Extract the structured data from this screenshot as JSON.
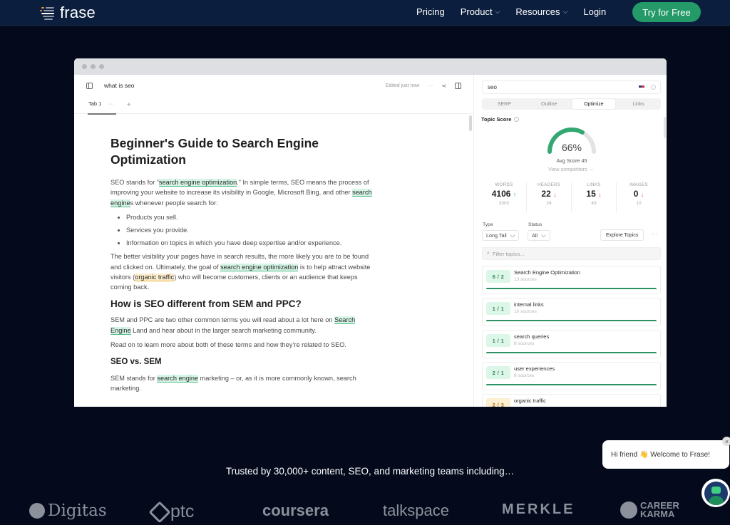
{
  "nav": {
    "brand": "frase",
    "links": [
      {
        "label": "Pricing",
        "has_dropdown": false
      },
      {
        "label": "Product",
        "has_dropdown": true
      },
      {
        "label": "Resources",
        "has_dropdown": true
      },
      {
        "label": "Login",
        "has_dropdown": false
      }
    ],
    "cta": "Try for Free",
    "chevron": "⌄"
  },
  "editor": {
    "doc_title": "what is seo",
    "edited_status": "Edited just now",
    "more": "···",
    "tabs": [
      {
        "label": "Tab 1",
        "more": "···"
      }
    ],
    "add_tab": "+",
    "content": {
      "h1": "Beginner's Guide to Search Engine Optimization",
      "p1": {
        "a": "SEO stands for “",
        "hl1": "search engine optimization",
        "b": ".” In simple terms, SEO means the process of improving your website to increase its visibility in Google, Microsoft Bing, and other ",
        "hl2": "search engine",
        "c": "s whenever people search for:"
      },
      "bullets": [
        "Products you sell.",
        "Services you provide.",
        "Information on topics in which you have deep expertise and/or experience."
      ],
      "p2": {
        "a": "The better visibility your pages have in search results, the more likely you are to be found and clicked on. Ultimately, the goal of ",
        "hl1": "search engine optimization",
        "b": " is to help attract website visitors (",
        "hl2": "organic traffic",
        "c": ") who will become customers, clients or an audience that keeps coming back."
      },
      "h2": "How is SEO different from SEM and PPC?",
      "p3": {
        "a": "SEM and PPC are two other common terms you will read about a lot here on ",
        "hl1": "Search Engine",
        "b": " Land and hear about in the larger search marketing community."
      },
      "p4": "Read on to learn more about both of these terms and how they’re related to SEO.",
      "h3": "SEO vs. SEM",
      "p5": {
        "a": "SEM stands for ",
        "hl1": "search engine",
        "b": " marketing – or, as it is more commonly known, search marketing."
      }
    }
  },
  "side": {
    "query": "seo",
    "tabs": [
      "SERP",
      "Outline",
      "Optimize",
      "Links"
    ],
    "active_tab": "Optimize",
    "topic_score_label": "Topic Score",
    "score_percent": 66,
    "score_display": "66%",
    "avg_score": "Avg Score 45",
    "view_competitors": "View competitors →",
    "metrics": [
      {
        "label": "WORDS",
        "value": "4106",
        "trend": "↑",
        "dir": "up",
        "target": "3302"
      },
      {
        "label": "HEADERS",
        "value": "22",
        "trend": "↓",
        "dir": "down",
        "target": "24"
      },
      {
        "label": "LINKS",
        "value": "15",
        "trend": "↓",
        "dir": "down",
        "target": "43"
      },
      {
        "label": "IMAGES",
        "value": "0",
        "trend": "↓",
        "dir": "down",
        "target": "10"
      }
    ],
    "type_label": "Type",
    "type_value": "Long Tail",
    "status_label": "Status",
    "status_value": "All",
    "explore_topics": "Explore Topics",
    "more": "···",
    "filter_placeholder": "Filter topics...",
    "topics": [
      {
        "badge": "6 / 2",
        "name": "Search Engine Optimization",
        "sources": "13 sources",
        "status": "ok"
      },
      {
        "badge": "1 / 1",
        "name": "internal links",
        "sources": "10 sources",
        "status": "ok"
      },
      {
        "badge": "1 / 1",
        "name": "search queries",
        "sources": "8 sources",
        "status": "ok"
      },
      {
        "badge": "2 / 1",
        "name": "user experiences",
        "sources": "8 sources",
        "status": "ok"
      },
      {
        "badge": "2 / 3",
        "name": "organic traffic",
        "sources": "",
        "status": "warn"
      }
    ]
  },
  "trusted_text": "Trusted by 30,000+ content, SEO, and marketing teams including…",
  "companies": [
    "Digitas",
    "ptc",
    "coursera",
    "talkspace",
    "MERKLE",
    "CAREER KARMA"
  ],
  "chat": {
    "greeting": "Hi friend 👋 Welcome to Frase!",
    "close": "×"
  },
  "colors": {
    "nav_bg": "#0b1e3d",
    "page_bg": "#040a1c",
    "brand_green": "#239a68",
    "highlight_green": "#d6f5e6",
    "highlight_yellow": "#fdeecd"
  }
}
